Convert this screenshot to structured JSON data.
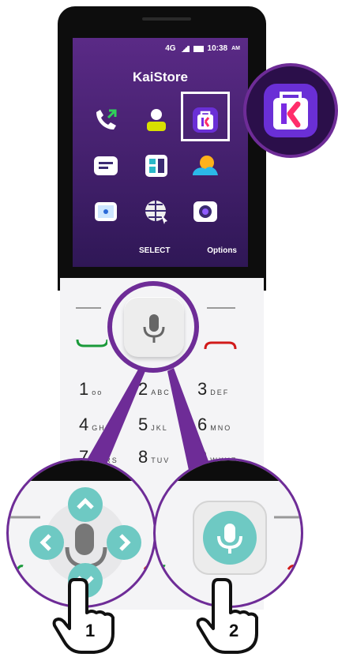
{
  "status": {
    "network": "4G",
    "time": "10:38",
    "ampm": "AM"
  },
  "screen": {
    "title": "KaiStore",
    "softkeys": {
      "center": "SELECT",
      "right": "Options"
    },
    "apps": [
      {
        "name": "phone-app",
        "icon": "phone-icon"
      },
      {
        "name": "contacts-app",
        "icon": "contacts-icon"
      },
      {
        "name": "kaistore-app",
        "icon": "kaistore-icon",
        "selected": true
      },
      {
        "name": "messages-app",
        "icon": "message-icon"
      },
      {
        "name": "notes-app",
        "icon": "notes-icon"
      },
      {
        "name": "weather-app",
        "icon": "weather-icon"
      },
      {
        "name": "radio-app",
        "icon": "radio-icon"
      },
      {
        "name": "browser-app",
        "icon": "browser-icon"
      },
      {
        "name": "camera-app",
        "icon": "camera-icon"
      }
    ]
  },
  "keypad": {
    "rows": [
      [
        {
          "digit": "1",
          "letters": "oo"
        },
        {
          "digit": "2",
          "letters": "ABC"
        },
        {
          "digit": "3",
          "letters": "DEF"
        }
      ],
      [
        {
          "digit": "4",
          "letters": "GHI"
        },
        {
          "digit": "5",
          "letters": "JKL"
        },
        {
          "digit": "6",
          "letters": "MNO"
        }
      ],
      [
        {
          "digit": "7",
          "letters": "PQRS"
        },
        {
          "digit": "8",
          "letters": "TUV"
        },
        {
          "digit": "9",
          "letters": "WXYZ"
        }
      ]
    ]
  },
  "steps": {
    "one": "1",
    "two": "2"
  },
  "colors": {
    "accent": "#6e2c97",
    "teal": "#6ec9c3",
    "call_green": "#1a9a3a",
    "end_red": "#d11a1a"
  }
}
